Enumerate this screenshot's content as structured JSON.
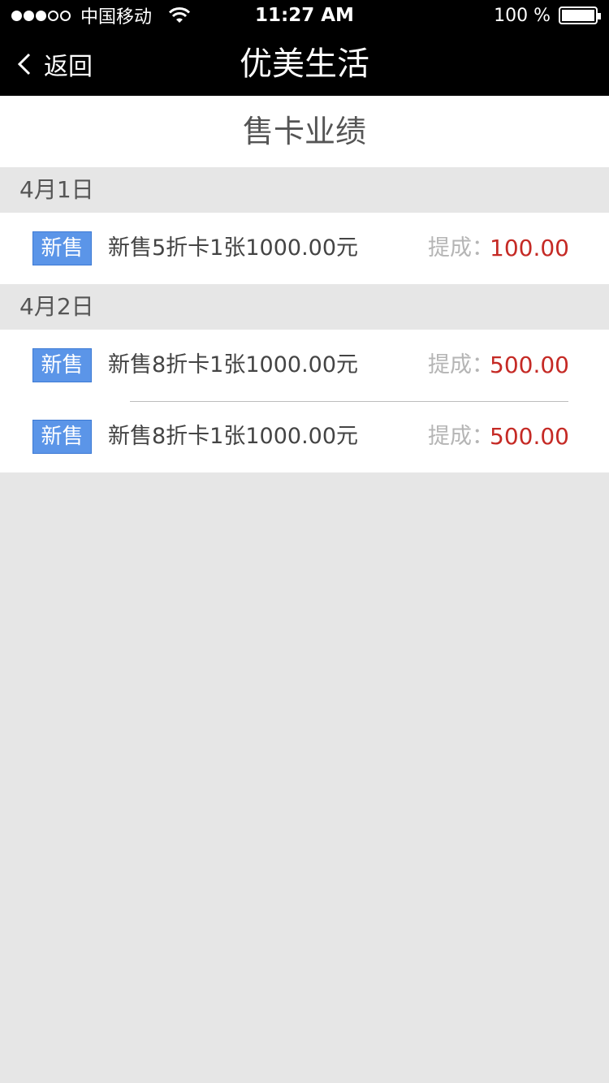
{
  "status_bar": {
    "carrier": "中国移动",
    "time": "11:27 AM",
    "battery": "100 %",
    "signal_bars_filled": 3,
    "signal_bars_total": 5
  },
  "nav": {
    "back_label": "返回",
    "title": "优美生活"
  },
  "page": {
    "subtitle": "售卡业绩"
  },
  "groups": [
    {
      "date": "4月1日",
      "items": [
        {
          "tag": "新售",
          "description": "新售5折卡1张1000.00元",
          "commission_label": "提成：",
          "commission": "100.00"
        }
      ]
    },
    {
      "date": "4月2日",
      "items": [
        {
          "tag": "新售",
          "description": "新售8折卡1张1000.00元",
          "commission_label": "提成：",
          "commission": "500.00"
        },
        {
          "tag": "新售",
          "description": "新售8折卡1张1000.00元",
          "commission_label": "提成：",
          "commission": "500.00"
        }
      ]
    }
  ],
  "colors": {
    "badge": "#5b95e8",
    "commission": "#c52a25",
    "bar": "#000000",
    "background": "#e6e6e6"
  }
}
